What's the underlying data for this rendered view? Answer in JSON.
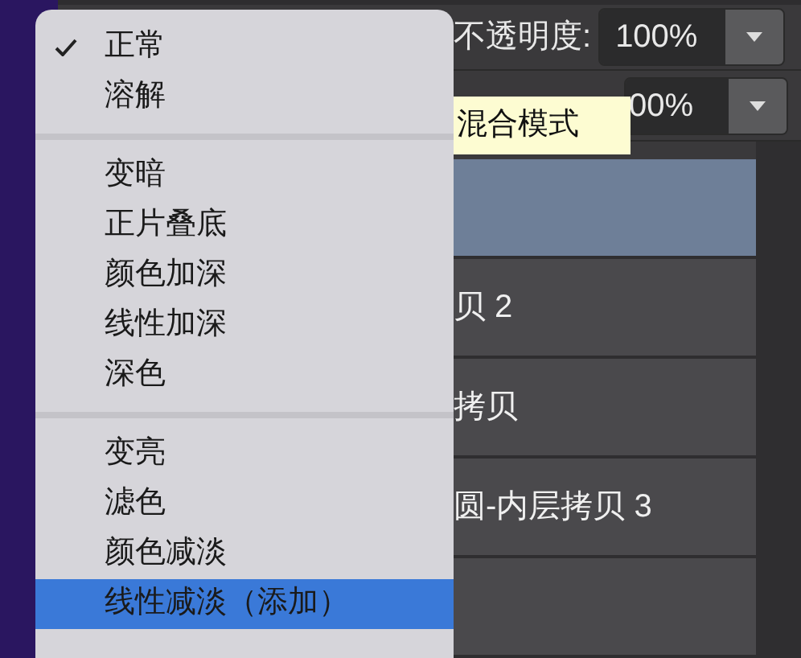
{
  "opacity": {
    "label": "不透明度:",
    "value": "100%"
  },
  "fill": {
    "value": "00%"
  },
  "tooltip": {
    "text": "混合模式"
  },
  "layers": [
    {
      "selected": true
    },
    {
      "name": "贝 2",
      "selected": false
    },
    {
      "name": "拷贝",
      "selected": false
    },
    {
      "name": "圆-内层拷贝 3",
      "selected": false
    },
    {
      "selected": false
    }
  ],
  "blend_menu": [
    [
      {
        "label": "正常",
        "checked": true,
        "selected": false
      },
      {
        "label": "溶解",
        "checked": false,
        "selected": false
      }
    ],
    [
      {
        "label": "变暗",
        "checked": false,
        "selected": false
      },
      {
        "label": "正片叠底",
        "checked": false,
        "selected": false
      },
      {
        "label": "颜色加深",
        "checked": false,
        "selected": false
      },
      {
        "label": "线性加深",
        "checked": false,
        "selected": false
      },
      {
        "label": "深色",
        "checked": false,
        "selected": false
      }
    ],
    [
      {
        "label": "变亮",
        "checked": false,
        "selected": false
      },
      {
        "label": "滤色",
        "checked": false,
        "selected": false
      },
      {
        "label": "颜色减淡",
        "checked": false,
        "selected": false
      },
      {
        "label": "线性减淡（添加）",
        "checked": false,
        "selected": true
      }
    ]
  ]
}
